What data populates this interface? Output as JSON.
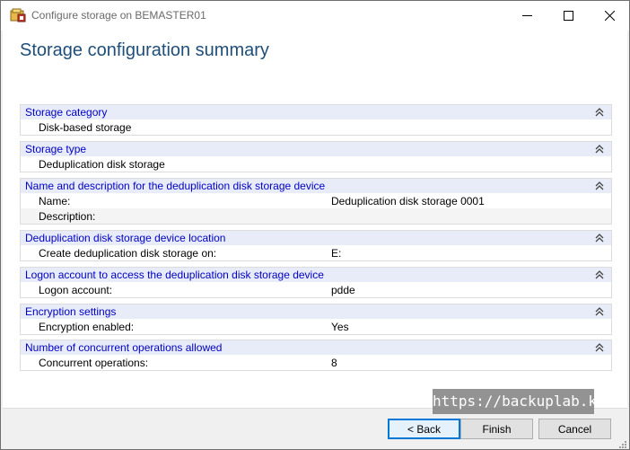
{
  "window": {
    "title": "Configure storage on BEMASTER01",
    "icon": "storage-config-icon"
  },
  "page": {
    "title": "Storage configuration summary"
  },
  "sections": [
    {
      "title": "Storage category",
      "rows": [
        {
          "label": "Disk-based storage",
          "value": ""
        }
      ]
    },
    {
      "title": "Storage type",
      "rows": [
        {
          "label": "Deduplication disk storage",
          "value": ""
        }
      ]
    },
    {
      "title": "Name and description for the deduplication disk storage device",
      "rows": [
        {
          "label": "Name:",
          "value": "Deduplication disk storage 0001"
        },
        {
          "label": "Description:",
          "value": ""
        }
      ]
    },
    {
      "title": "Deduplication disk storage device location",
      "rows": [
        {
          "label": "Create deduplication disk storage on:",
          "value": "E:"
        }
      ]
    },
    {
      "title": "Logon account to access the deduplication disk storage device",
      "rows": [
        {
          "label": "Logon account:",
          "value": "pdde"
        }
      ]
    },
    {
      "title": "Encryption settings",
      "rows": [
        {
          "label": "Encryption enabled:",
          "value": "Yes"
        }
      ]
    },
    {
      "title": "Number of concurrent operations allowed",
      "rows": [
        {
          "label": "Concurrent operations:",
          "value": "8"
        }
      ]
    }
  ],
  "watermark": "https://backuplab.kr",
  "buttons": {
    "back": "< Back",
    "finish": "Finish",
    "cancel": "Cancel"
  },
  "colors": {
    "section_title": "#0000c8",
    "section_header_bg": "#e8ecf8",
    "page_title": "#1f4e79",
    "default_button_border": "#0078d7"
  }
}
